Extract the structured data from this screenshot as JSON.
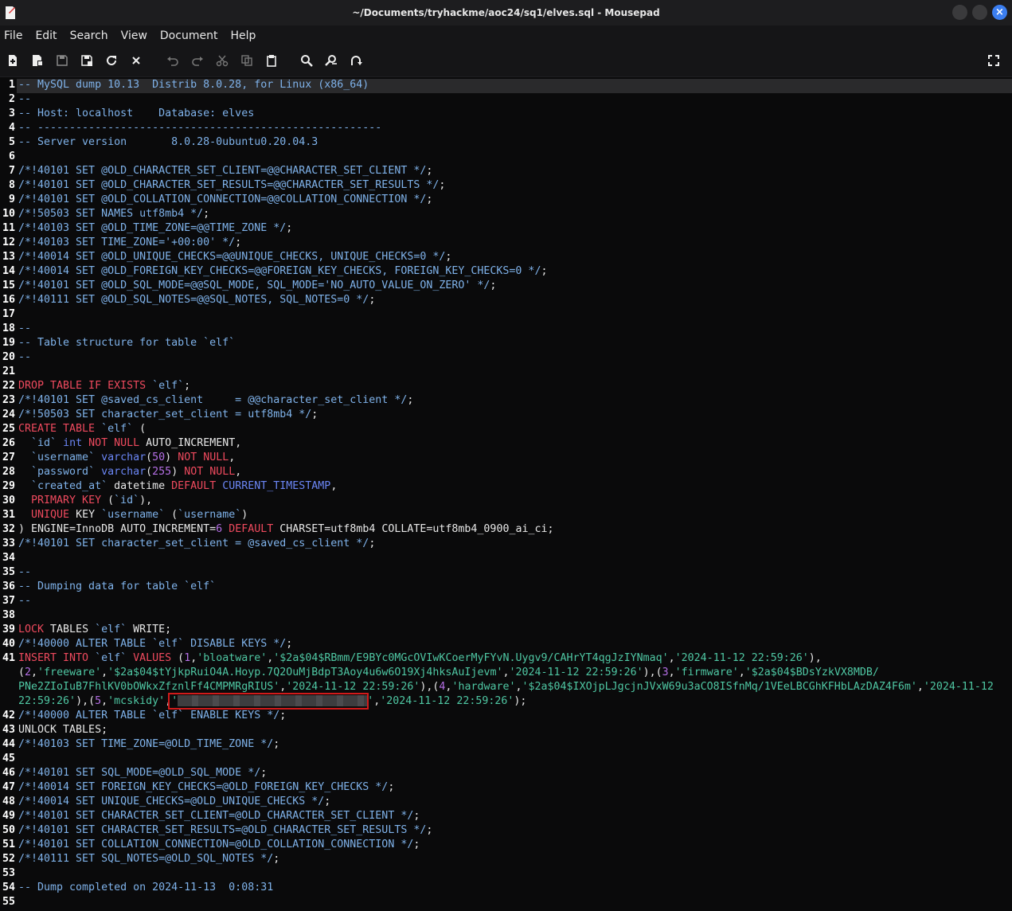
{
  "window": {
    "title": "~/Documents/tryhackme/aoc24/sq1/elves.sql - Mousepad"
  },
  "menu": [
    "File",
    "Edit",
    "Search",
    "View",
    "Document",
    "Help"
  ],
  "toolbar": [
    "new-file-icon",
    "new-window-icon",
    "save-icon",
    "save-as-icon",
    "reload-icon",
    "close-icon",
    "undo-icon",
    "redo-icon",
    "cut-icon",
    "copy-icon",
    "paste-icon",
    "find-icon",
    "find-replace-icon",
    "goto-line-icon",
    "fullscreen-icon"
  ],
  "colors": {
    "comment": "#7fb2ea",
    "keyword": "#ef4a5e",
    "function": "#6b86f5",
    "string": "#4fc7a3",
    "number": "#b56fe6",
    "highlight_box": "#d11a1a"
  },
  "line_numbers": [
    "1",
    "2",
    "3",
    "4",
    "5",
    "6",
    "7",
    "8",
    "9",
    "10",
    "11",
    "12",
    "13",
    "14",
    "15",
    "16",
    "17",
    "18",
    "19",
    "20",
    "21",
    "22",
    "23",
    "24",
    "25",
    "26",
    "27",
    "28",
    "29",
    "30",
    "31",
    "32",
    "33",
    "34",
    "35",
    "36",
    "37",
    "38",
    "39",
    "40",
    "41",
    "42",
    "43",
    "44",
    "45",
    "46",
    "47",
    "48",
    "49",
    "50",
    "51",
    "52",
    "53",
    "54",
    "55"
  ],
  "lines": [
    [
      [
        "c",
        "-- MySQL dump 10.13  Distrib 8.0.28, for Linux (x86_64)"
      ]
    ],
    [
      [
        "c",
        "--"
      ]
    ],
    [
      [
        "c",
        "-- Host: localhost    Database: elves"
      ]
    ],
    [
      [
        "c",
        "-- ------------------------------------------------------"
      ]
    ],
    [
      [
        "c",
        "-- Server version\t8.0.28-0ubuntu0.20.04.3"
      ]
    ],
    [],
    [
      [
        "c",
        "/*!40101 SET @OLD_CHARACTER_SET_CLIENT=@@CHARACTER_SET_CLIENT */"
      ],
      [
        "t",
        ";"
      ]
    ],
    [
      [
        "c",
        "/*!40101 SET @OLD_CHARACTER_SET_RESULTS=@@CHARACTER_SET_RESULTS */"
      ],
      [
        "t",
        ";"
      ]
    ],
    [
      [
        "c",
        "/*!40101 SET @OLD_COLLATION_CONNECTION=@@COLLATION_CONNECTION */"
      ],
      [
        "t",
        ";"
      ]
    ],
    [
      [
        "c",
        "/*!50503 SET NAMES utf8mb4 */"
      ],
      [
        "t",
        ";"
      ]
    ],
    [
      [
        "c",
        "/*!40103 SET @OLD_TIME_ZONE=@@TIME_ZONE */"
      ],
      [
        "t",
        ";"
      ]
    ],
    [
      [
        "c",
        "/*!40103 SET TIME_ZONE='+00:00' */"
      ],
      [
        "t",
        ";"
      ]
    ],
    [
      [
        "c",
        "/*!40014 SET @OLD_UNIQUE_CHECKS=@@UNIQUE_CHECKS, UNIQUE_CHECKS=0 */"
      ],
      [
        "t",
        ";"
      ]
    ],
    [
      [
        "c",
        "/*!40014 SET @OLD_FOREIGN_KEY_CHECKS=@@FOREIGN_KEY_CHECKS, FOREIGN_KEY_CHECKS=0 */"
      ],
      [
        "t",
        ";"
      ]
    ],
    [
      [
        "c",
        "/*!40101 SET @OLD_SQL_MODE=@@SQL_MODE, SQL_MODE='NO_AUTO_VALUE_ON_ZERO' */"
      ],
      [
        "t",
        ";"
      ]
    ],
    [
      [
        "c",
        "/*!40111 SET @OLD_SQL_NOTES=@@SQL_NOTES, SQL_NOTES=0 */"
      ],
      [
        "t",
        ";"
      ]
    ],
    [],
    [
      [
        "c",
        "--"
      ]
    ],
    [
      [
        "c",
        "-- Table structure for table `elf`"
      ]
    ],
    [
      [
        "c",
        "--"
      ]
    ],
    [],
    [
      [
        "k",
        "DROP TABLE IF EXISTS "
      ],
      [
        "c",
        "`elf`"
      ],
      [
        "t",
        ";"
      ]
    ],
    [
      [
        "c",
        "/*!40101 SET @saved_cs_client     = @@character_set_client */"
      ],
      [
        "t",
        ";"
      ]
    ],
    [
      [
        "c",
        "/*!50503 SET character_set_client = utf8mb4 */"
      ],
      [
        "t",
        ";"
      ]
    ],
    [
      [
        "k",
        "CREATE TABLE "
      ],
      [
        "c",
        "`elf`"
      ],
      [
        "t",
        " ("
      ]
    ],
    [
      [
        "t",
        "  "
      ],
      [
        "c",
        "`id`"
      ],
      [
        "t",
        " "
      ],
      [
        "f",
        "int"
      ],
      [
        "t",
        " "
      ],
      [
        "k",
        "NOT NULL"
      ],
      [
        "t",
        " AUTO_INCREMENT,"
      ]
    ],
    [
      [
        "t",
        "  "
      ],
      [
        "c",
        "`username`"
      ],
      [
        "t",
        " "
      ],
      [
        "f",
        "varchar"
      ],
      [
        "t",
        "("
      ],
      [
        "n",
        "50"
      ],
      [
        "t",
        ") "
      ],
      [
        "k",
        "NOT NULL"
      ],
      [
        "t",
        ","
      ]
    ],
    [
      [
        "t",
        "  "
      ],
      [
        "c",
        "`password`"
      ],
      [
        "t",
        " "
      ],
      [
        "f",
        "varchar"
      ],
      [
        "t",
        "("
      ],
      [
        "n",
        "255"
      ],
      [
        "t",
        ") "
      ],
      [
        "k",
        "NOT NULL"
      ],
      [
        "t",
        ","
      ]
    ],
    [
      [
        "t",
        "  "
      ],
      [
        "c",
        "`created_at`"
      ],
      [
        "t",
        " datetime "
      ],
      [
        "k",
        "DEFAULT"
      ],
      [
        "t",
        " "
      ],
      [
        "f",
        "CURRENT_TIMESTAMP"
      ],
      [
        "t",
        ","
      ]
    ],
    [
      [
        "t",
        "  "
      ],
      [
        "k",
        "PRIMARY KEY"
      ],
      [
        "t",
        " ("
      ],
      [
        "c",
        "`id`"
      ],
      [
        "t",
        "),"
      ]
    ],
    [
      [
        "t",
        "  "
      ],
      [
        "k",
        "UNIQUE"
      ],
      [
        "t",
        " KEY "
      ],
      [
        "c",
        "`username`"
      ],
      [
        "t",
        " ("
      ],
      [
        "c",
        "`username`"
      ],
      [
        "t",
        ")"
      ]
    ],
    [
      [
        "t",
        ") ENGINE=InnoDB AUTO_INCREMENT="
      ],
      [
        "n",
        "6"
      ],
      [
        "t",
        " "
      ],
      [
        "k",
        "DEFAULT"
      ],
      [
        "t",
        " CHARSET=utf8mb4 COLLATE=utf8mb4_0900_ai_ci;"
      ]
    ],
    [
      [
        "c",
        "/*!40101 SET character_set_client = @saved_cs_client */"
      ],
      [
        "t",
        ";"
      ]
    ],
    [],
    [
      [
        "c",
        "--"
      ]
    ],
    [
      [
        "c",
        "-- Dumping data for table `elf`"
      ]
    ],
    [
      [
        "c",
        "--"
      ]
    ],
    [],
    [
      [
        "k",
        "LOCK"
      ],
      [
        "t",
        " TABLES "
      ],
      [
        "c",
        "`elf`"
      ],
      [
        "t",
        " WRITE;"
      ]
    ],
    [
      [
        "c",
        "/*!40000 ALTER TABLE `elf` DISABLE KEYS */"
      ],
      [
        "t",
        ";"
      ]
    ],
    [
      [
        "k",
        "INSERT INTO "
      ],
      [
        "c",
        "`elf`"
      ],
      [
        "t",
        " "
      ],
      [
        "k",
        "VALUES"
      ],
      [
        "t",
        " ("
      ],
      [
        "n",
        "1"
      ],
      [
        "t",
        ","
      ],
      [
        "s",
        "'bloatware'"
      ],
      [
        "t",
        ","
      ],
      [
        "s",
        "'$2a$04$RBmm/E9BYc0MGcOVIwKCoerMyFYvN.Uygv9/CAHrYT4qgJzIYNmaq'"
      ],
      [
        "t",
        ","
      ],
      [
        "s",
        "'2024-11-12 22:59:26'"
      ],
      [
        "t",
        "),"
      ]
    ],
    [
      [
        "t",
        "("
      ],
      [
        "n",
        "2"
      ],
      [
        "t",
        ","
      ],
      [
        "s",
        "'freeware'"
      ],
      [
        "t",
        ","
      ],
      [
        "s",
        "'$2a$04$tYjkpRuiO4A.Hoyp.7Q2OuMjBdpT3Aoy4u6w6O19Xj4hksAuIjevm'"
      ],
      [
        "t",
        ","
      ],
      [
        "s",
        "'2024-11-12 22:59:26'"
      ],
      [
        "t",
        "),("
      ],
      [
        "n",
        "3"
      ],
      [
        "t",
        ","
      ],
      [
        "s",
        "'firmware'"
      ],
      [
        "t",
        ","
      ],
      [
        "s",
        "'$2a$04$BDsYzkVX8MDB/"
      ]
    ],
    [
      [
        "s",
        "PNe2ZIoIuB7FhlKV0bOWkxZfznlFf4CMPMRgRIUS'"
      ],
      [
        "t",
        ","
      ],
      [
        "s",
        "'2024-11-12 22:59:26'"
      ],
      [
        "t",
        "),("
      ],
      [
        "n",
        "4"
      ],
      [
        "t",
        ","
      ],
      [
        "s",
        "'hardware'"
      ],
      [
        "t",
        ","
      ],
      [
        "s",
        "'$2a$04$IXOjpLJgcjnJVxW69u3aCO8ISfnMq/1VEeLBCGhKFHbLAzDAZ4F6m'"
      ],
      [
        "t",
        ","
      ],
      [
        "s",
        "'2024-11-12"
      ]
    ],
    [
      [
        "s",
        "22:59:26'"
      ],
      [
        "t",
        "),("
      ],
      [
        "n",
        "5"
      ],
      [
        "t",
        ","
      ],
      [
        "s",
        "'mcskidy'"
      ],
      [
        "t",
        ","
      ],
      [
        "s",
        "'"
      ],
      [
        "r",
        ""
      ],
      [
        "s",
        "'"
      ],
      [
        "t",
        ","
      ],
      [
        "s",
        "'2024-11-12 22:59:26'"
      ],
      [
        "t",
        ");"
      ]
    ],
    [
      [
        "c",
        "/*!40000 ALTER TABLE `elf` ENABLE KEYS */"
      ],
      [
        "t",
        ";"
      ]
    ],
    [
      [
        "t",
        "UNLOCK TABLES;"
      ]
    ],
    [
      [
        "c",
        "/*!40103 SET TIME_ZONE=@OLD_TIME_ZONE */"
      ],
      [
        "t",
        ";"
      ]
    ],
    [],
    [
      [
        "c",
        "/*!40101 SET SQL_MODE=@OLD_SQL_MODE */"
      ],
      [
        "t",
        ";"
      ]
    ],
    [
      [
        "c",
        "/*!40014 SET FOREIGN_KEY_CHECKS=@OLD_FOREIGN_KEY_CHECKS */"
      ],
      [
        "t",
        ";"
      ]
    ],
    [
      [
        "c",
        "/*!40014 SET UNIQUE_CHECKS=@OLD_UNIQUE_CHECKS */"
      ],
      [
        "t",
        ";"
      ]
    ],
    [
      [
        "c",
        "/*!40101 SET CHARACTER_SET_CLIENT=@OLD_CHARACTER_SET_CLIENT */"
      ],
      [
        "t",
        ";"
      ]
    ],
    [
      [
        "c",
        "/*!40101 SET CHARACTER_SET_RESULTS=@OLD_CHARACTER_SET_RESULTS */"
      ],
      [
        "t",
        ";"
      ]
    ],
    [
      [
        "c",
        "/*!40101 SET COLLATION_CONNECTION=@OLD_COLLATION_CONNECTION */"
      ],
      [
        "t",
        ";"
      ]
    ],
    [
      [
        "c",
        "/*!40111 SET SQL_NOTES=@OLD_SQL_NOTES */"
      ],
      [
        "t",
        ";"
      ]
    ],
    [],
    [
      [
        "c",
        "-- Dump completed on 2024-11-13  0:08:31"
      ]
    ],
    []
  ]
}
